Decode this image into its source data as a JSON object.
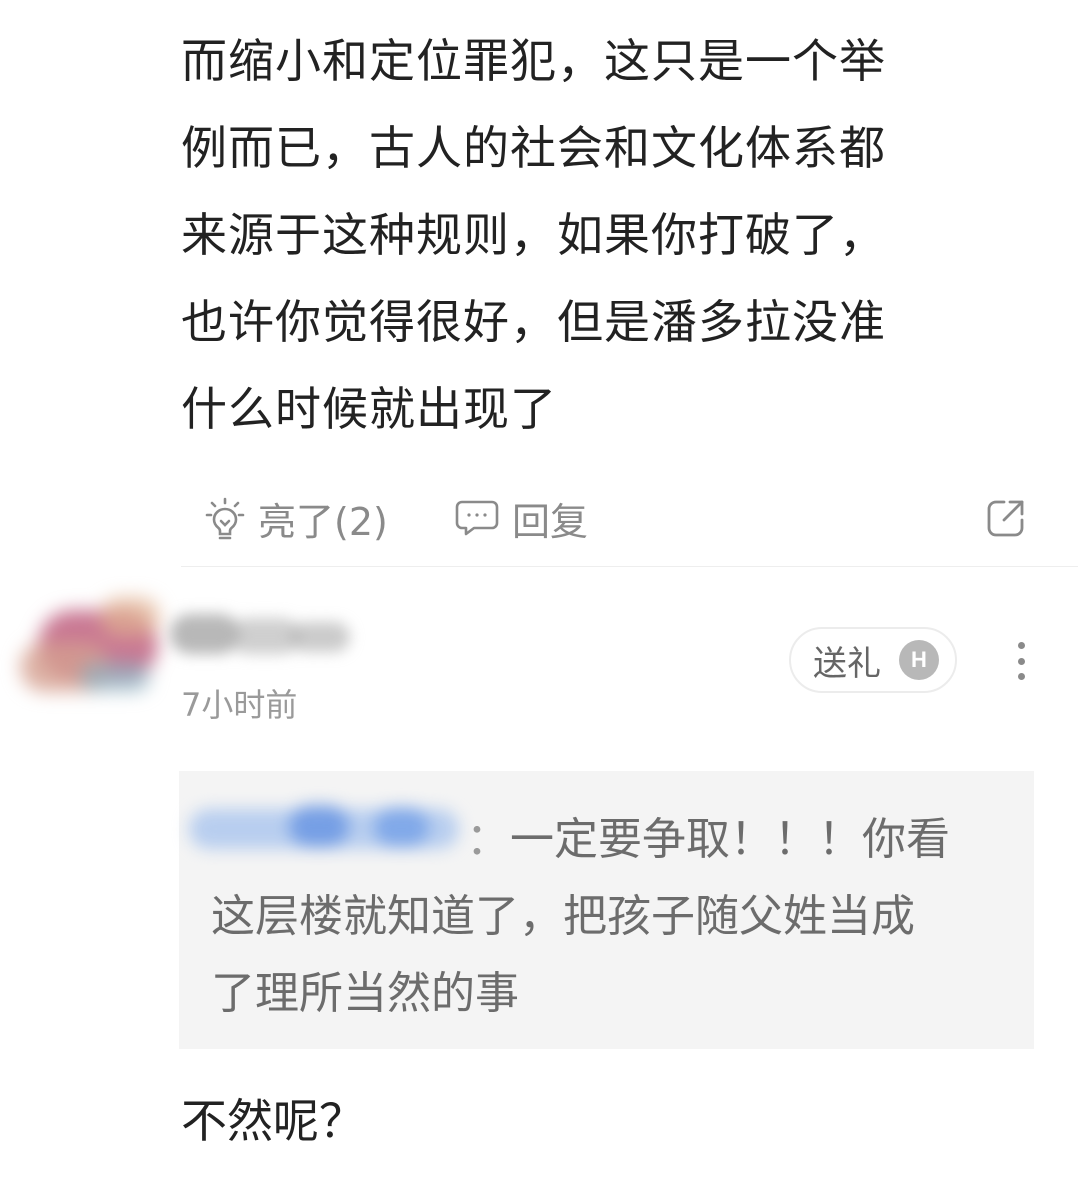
{
  "post": {
    "lines": [
      "而缩小和定位罪犯，这只是一个举",
      "例而已，古人的社会和文化体系都",
      "来源于这种规则，如果你打破了，",
      "也许你觉得很好，但是潘多拉没准",
      "什么时候就出现了"
    ]
  },
  "actions": {
    "like_label": "亮了(2)",
    "reply_label": "回复",
    "like_icon": "lightbulb-icon",
    "reply_icon": "chat-bubble-icon",
    "share_icon": "share-icon"
  },
  "comment": {
    "timestamp": "7小时前",
    "gift_label": "送礼",
    "gift_badge": "H",
    "quote": {
      "separator": "：",
      "lines": [
        "一定要争取！！！你看",
        "这层楼就知道了，把孩子随父姓当成",
        "了理所当然的事"
      ]
    },
    "reply": "不然呢？"
  },
  "colors": {
    "text_primary": "#222222",
    "text_secondary": "#8a8a8a",
    "quote_background": "#f4f4f4",
    "quote_text": "#6c6c6c",
    "divider": "#eeeeee"
  }
}
